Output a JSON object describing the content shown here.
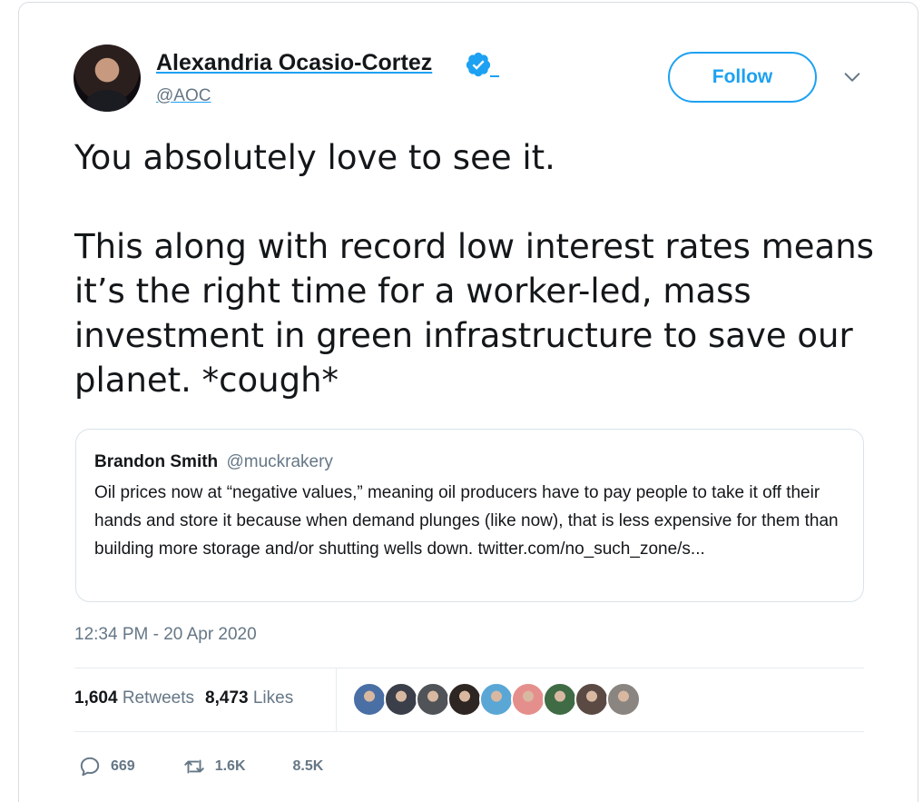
{
  "tweet": {
    "author_name": "Alexandria Ocasio-Cortez",
    "author_handle": "@AOC",
    "follow_label": "Follow",
    "text": "You absolutely love to see it.\n\nThis along with record low interest rates means it’s the right time for a worker-led, mass investment in green infrastructure to save our planet. *cough*",
    "timestamp": "12:34 PM - 20 Apr 2020"
  },
  "quoted_tweet": {
    "author_name": "Brandon Smith",
    "author_handle": "@muckrakery",
    "text": "Oil prices now at “negative values,” meaning oil producers have to pay people to take it off their hands and store it because when demand plunges (like now), that is less expensive for them than building more storage and/or shutting wells down. twitter.com/no_such_zone/s..."
  },
  "stats": {
    "retweets_count": "1,604",
    "retweets_label": "Retweets",
    "likes_count": "8,473",
    "likes_label": "Likes"
  },
  "likers": [
    {
      "color": "#4a6fa5",
      "icon": "avatar"
    },
    {
      "color": "#3b3f4a",
      "icon": "avatar"
    },
    {
      "color": "#505357",
      "icon": "avatar"
    },
    {
      "color": "#2e2622",
      "icon": "avatar"
    },
    {
      "color": "#5aa7d6",
      "icon": "avatar"
    },
    {
      "color": "#e58f8c",
      "icon": "avatar"
    },
    {
      "color": "#3f6b45",
      "icon": "avatar"
    },
    {
      "color": "#5b4a44",
      "icon": "avatar"
    },
    {
      "color": "#8a8580",
      "icon": "avatar"
    }
  ],
  "actions": {
    "reply_count": "669",
    "retweet_count": "1.6K",
    "like_count": "8.5K"
  },
  "colors": {
    "accent": "#1da1f2",
    "secondary_text": "#657786",
    "border": "#e6ecf0"
  }
}
